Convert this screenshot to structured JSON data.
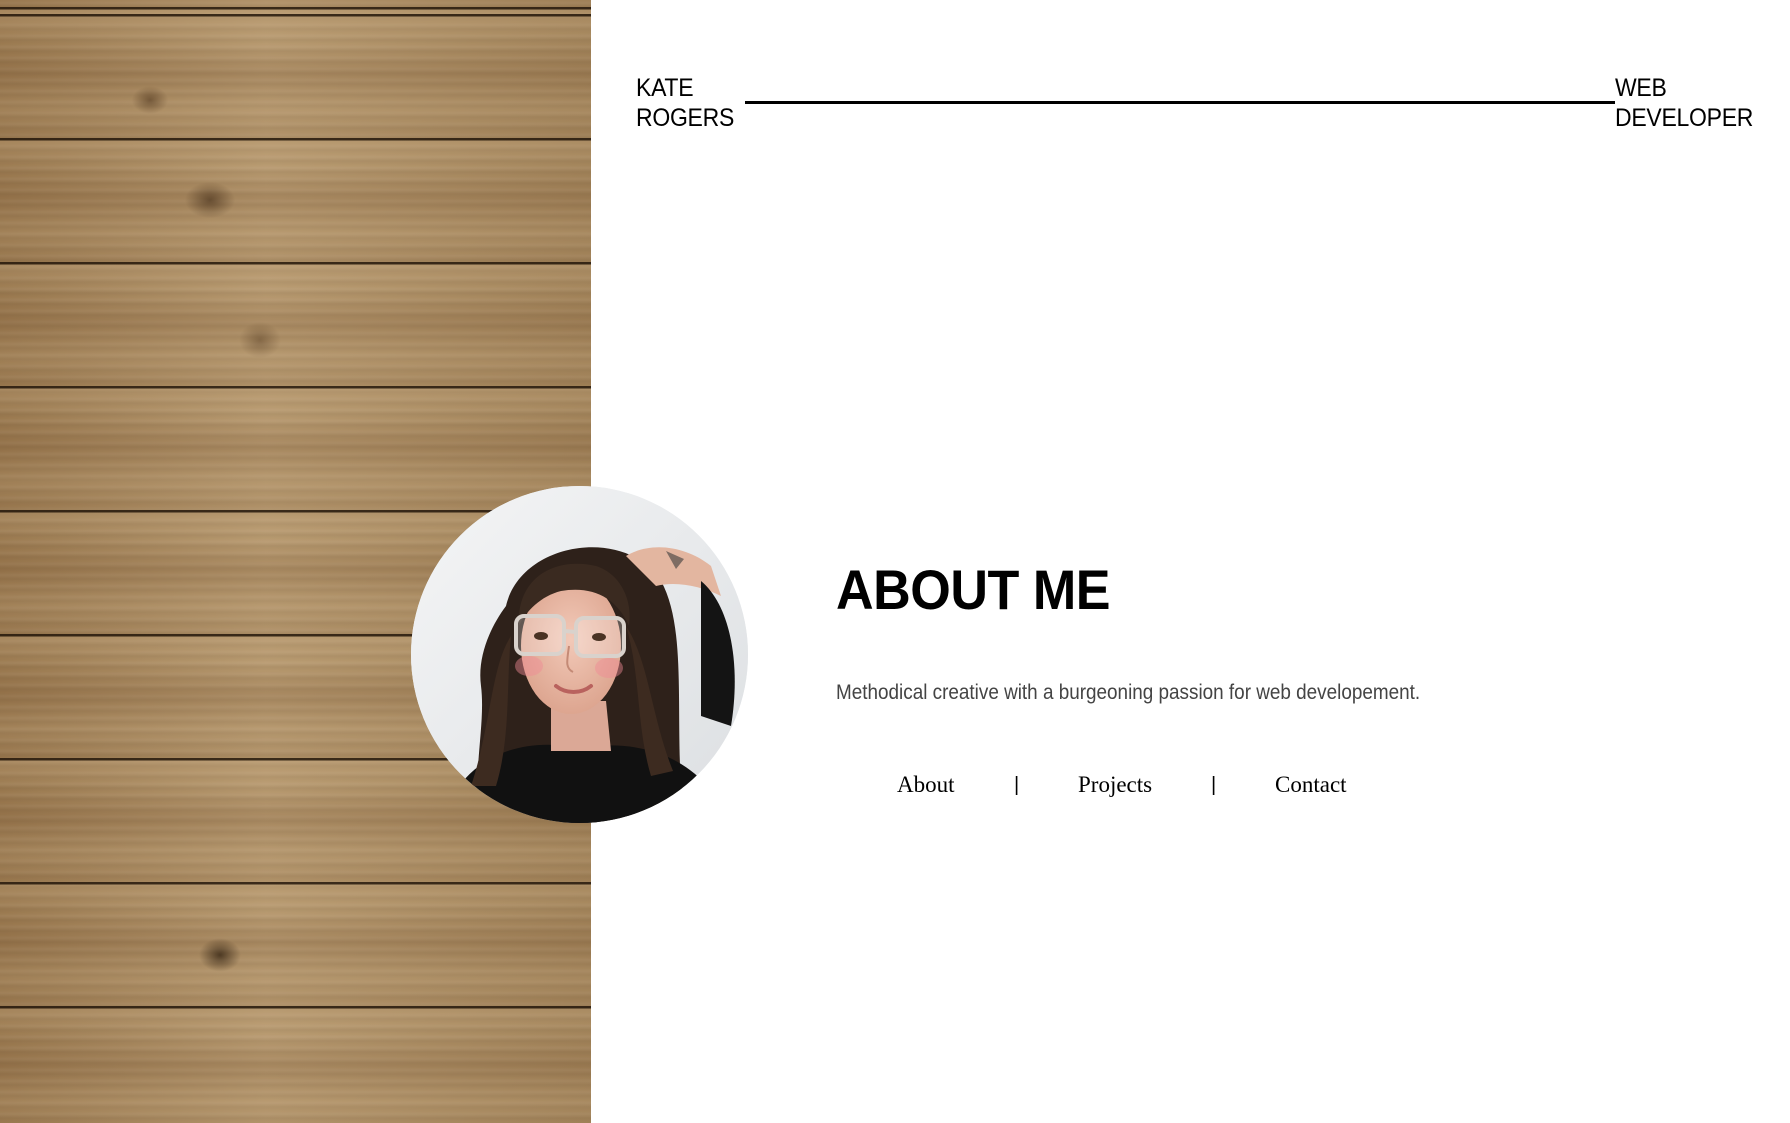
{
  "header": {
    "name_line1": "KATE",
    "name_line2": "ROGERS",
    "role_line1": "WEB",
    "role_line2": "DEVELOPER"
  },
  "about": {
    "heading": "ABOUT ME",
    "tagline": "Methodical creative with a burgeoning passion for web developement."
  },
  "nav": {
    "items": [
      {
        "label": "About"
      },
      {
        "label": "Projects"
      },
      {
        "label": "Contact"
      }
    ],
    "separator": "|"
  },
  "colors": {
    "text": "#000000",
    "tagline": "#444444",
    "wood": "#a98a62",
    "background": "#ffffff"
  }
}
